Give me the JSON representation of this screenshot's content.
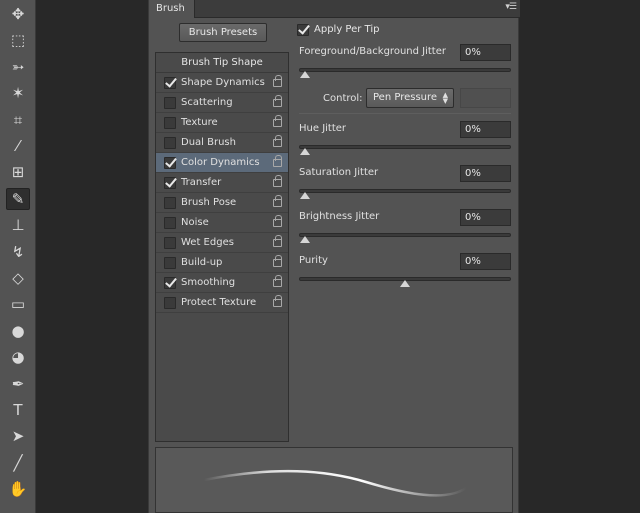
{
  "toolbar": {
    "tools": [
      {
        "name": "move-tool-icon",
        "glyph": "✥",
        "active": false
      },
      {
        "name": "marquee-tool-icon",
        "glyph": "⬚",
        "active": false
      },
      {
        "name": "lasso-tool-icon",
        "glyph": "➳",
        "active": false
      },
      {
        "name": "magic-wand-tool-icon",
        "glyph": "✶",
        "active": false
      },
      {
        "name": "crop-tool-icon",
        "glyph": "⌗",
        "active": false
      },
      {
        "name": "eyedropper-tool-icon",
        "glyph": "⁄",
        "active": false
      },
      {
        "name": "healing-brush-tool-icon",
        "glyph": "⊞",
        "active": false
      },
      {
        "name": "brush-tool-icon",
        "glyph": "✎",
        "active": true
      },
      {
        "name": "clone-stamp-tool-icon",
        "glyph": "⊥",
        "active": false
      },
      {
        "name": "history-brush-tool-icon",
        "glyph": "↯",
        "active": false
      },
      {
        "name": "eraser-tool-icon",
        "glyph": "◇",
        "active": false
      },
      {
        "name": "gradient-tool-icon",
        "glyph": "▭",
        "active": false
      },
      {
        "name": "blur-tool-icon",
        "glyph": "●",
        "active": false
      },
      {
        "name": "dodge-tool-icon",
        "glyph": "◕",
        "active": false
      },
      {
        "name": "pen-tool-icon",
        "glyph": "✒",
        "active": false
      },
      {
        "name": "type-tool-icon",
        "glyph": "T",
        "active": false
      },
      {
        "name": "path-selection-tool-icon",
        "glyph": "➤",
        "active": false
      },
      {
        "name": "line-tool-icon",
        "glyph": "╱",
        "active": false
      },
      {
        "name": "hand-tool-icon",
        "glyph": "✋",
        "active": false
      }
    ]
  },
  "panel": {
    "tab_label": "Brush",
    "presets_button": "Brush Presets",
    "list_header": "Brush Tip Shape",
    "items": [
      {
        "label": "Shape Dynamics",
        "checked": true,
        "selected": false
      },
      {
        "label": "Scattering",
        "checked": false,
        "selected": false
      },
      {
        "label": "Texture",
        "checked": false,
        "selected": false
      },
      {
        "label": "Dual Brush",
        "checked": false,
        "selected": false
      },
      {
        "label": "Color Dynamics",
        "checked": true,
        "selected": true
      },
      {
        "label": "Transfer",
        "checked": true,
        "selected": false
      },
      {
        "label": "Brush Pose",
        "checked": false,
        "selected": false
      },
      {
        "label": "Noise",
        "checked": false,
        "selected": false
      },
      {
        "label": "Wet Edges",
        "checked": false,
        "selected": false
      },
      {
        "label": "Build-up",
        "checked": false,
        "selected": false
      },
      {
        "label": "Smoothing",
        "checked": true,
        "selected": false
      },
      {
        "label": "Protect Texture",
        "checked": false,
        "selected": false
      }
    ],
    "apply_per_tip": {
      "label": "Apply Per Tip",
      "checked": true
    },
    "fg_bg_jitter": {
      "label": "Foreground/Background Jitter",
      "value": "0%",
      "fraction": 0.0
    },
    "control": {
      "label": "Control:",
      "value": "Pen Pressure"
    },
    "hue_jitter": {
      "label": "Hue Jitter",
      "value": "0%",
      "fraction": 0.0
    },
    "saturation_jitter": {
      "label": "Saturation Jitter",
      "value": "0%",
      "fraction": 0.0
    },
    "brightness_jitter": {
      "label": "Brightness Jitter",
      "value": "0%",
      "fraction": 0.0
    },
    "purity": {
      "label": "Purity",
      "value": "0%",
      "fraction": 0.5
    }
  },
  "colors": {
    "selected_row": "#5c6a7a",
    "panel_bg": "#535353"
  }
}
